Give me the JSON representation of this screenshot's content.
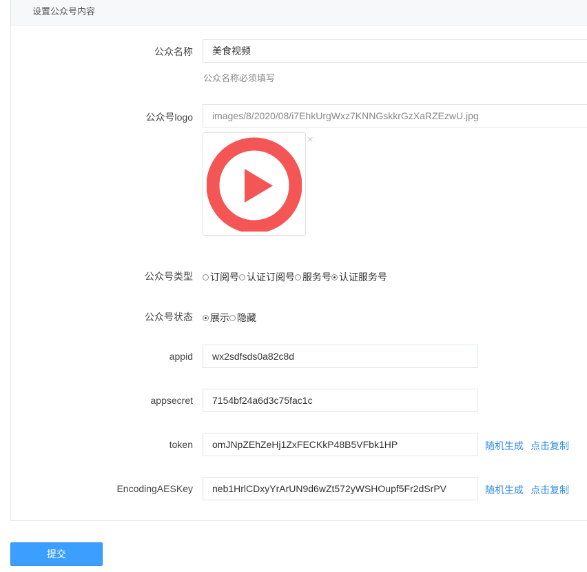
{
  "panel": {
    "title": "设置公众号内容"
  },
  "form": {
    "name": {
      "label": "公众名称",
      "value": "美食视频",
      "help": "公众名称必须填写"
    },
    "logo": {
      "label": "公众号logo",
      "value": "images/8/2020/08/i7EhkUrgWxz7KNNGskkrGzXaRZEzwU.jpg",
      "remove_icon": "×"
    },
    "type": {
      "label": "公众号类型",
      "options": [
        {
          "label": "订阅号",
          "checked": false
        },
        {
          "label": "认证订阅号",
          "checked": false
        },
        {
          "label": "服务号",
          "checked": false
        },
        {
          "label": "认证服务号",
          "checked": true
        }
      ]
    },
    "status": {
      "label": "公众号状态",
      "options": [
        {
          "label": "展示",
          "checked": true
        },
        {
          "label": "隐藏",
          "checked": false
        }
      ]
    },
    "appid": {
      "label": "appid",
      "value": "wx2sdfsds0a82c8d"
    },
    "appsecret": {
      "label": "appsecret",
      "value": "7154bf24a6d3c75fac1c"
    },
    "token": {
      "label": "token",
      "value": "omJNpZEhZeHj1ZxFECKkP48B5VFbk1HP",
      "generate": "随机生成",
      "copy": "点击复制"
    },
    "aeskey": {
      "label": "EncodingAESKey",
      "value": "neb1HrlCDxyYrArUN9d6wZt572yWSHOupf5Fr2dSrPV",
      "generate": "随机生成",
      "copy": "点击复制"
    }
  },
  "submit_label": "提交",
  "colors": {
    "accent": "#3c9eff",
    "link": "#2f8ee6",
    "logo_red": "#f45656"
  }
}
